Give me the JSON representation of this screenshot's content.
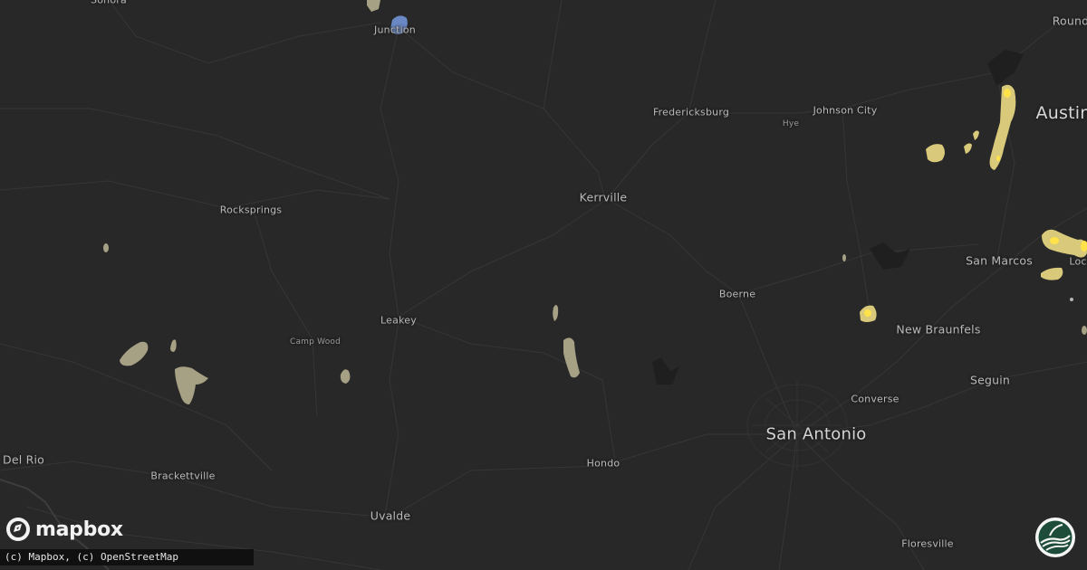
{
  "map": {
    "labels": [
      {
        "id": "sonora",
        "text": "Sonora",
        "size": "s-sm"
      },
      {
        "id": "junction",
        "text": "Junction",
        "size": "s-sm"
      },
      {
        "id": "fredericksburg",
        "text": "Fredericksburg",
        "size": "s-sm"
      },
      {
        "id": "hye",
        "text": "Hye",
        "size": "s-xs"
      },
      {
        "id": "johnson-city",
        "text": "Johnson City",
        "size": "s-sm"
      },
      {
        "id": "austin",
        "text": "Austin",
        "size": "s-xl"
      },
      {
        "id": "round-rock",
        "text": "Round",
        "size": "s-md"
      },
      {
        "id": "kerrville",
        "text": "Kerrville",
        "size": "s-md"
      },
      {
        "id": "rocksprings",
        "text": "Rocksprings",
        "size": "s-sm"
      },
      {
        "id": "san-marcos",
        "text": "San Marcos",
        "size": "s-md"
      },
      {
        "id": "lockhart",
        "text": "Loc",
        "size": "s-sm"
      },
      {
        "id": "boerne",
        "text": "Boerne",
        "size": "s-sm"
      },
      {
        "id": "leakey",
        "text": "Leakey",
        "size": "s-sm"
      },
      {
        "id": "camp-wood",
        "text": "Camp Wood",
        "size": "s-xs"
      },
      {
        "id": "new-braunfels",
        "text": "New Braunfels",
        "size": "s-md"
      },
      {
        "id": "seguin",
        "text": "Seguin",
        "size": "s-md"
      },
      {
        "id": "converse",
        "text": "Converse",
        "size": "s-sm"
      },
      {
        "id": "san-antonio",
        "text": "San Antonio",
        "size": "s-lg"
      },
      {
        "id": "del-rio",
        "text": "Del Rio",
        "size": "s-md"
      },
      {
        "id": "brackettville",
        "text": "Brackettville",
        "size": "s-sm"
      },
      {
        "id": "hondo",
        "text": "Hondo",
        "size": "s-sm"
      },
      {
        "id": "uvalde",
        "text": "Uvalde",
        "size": "s-md"
      },
      {
        "id": "floresville",
        "text": "Floresville",
        "size": "s-sm"
      }
    ]
  },
  "logo": {
    "text": "mapbox"
  },
  "attribution": {
    "text": "(c) Mapbox, (c) OpenStreetMap"
  },
  "colors": {
    "background": "#282828",
    "road": "#3a3a3a",
    "hail_small": "#a6a184",
    "hail_medium": "#d9c97a",
    "hail_large": "#ffe24a",
    "hail_blue": "#6a88c4"
  },
  "icons": {
    "mapbox": "mapbox-logo-icon",
    "brand": "hail-brand-icon"
  }
}
